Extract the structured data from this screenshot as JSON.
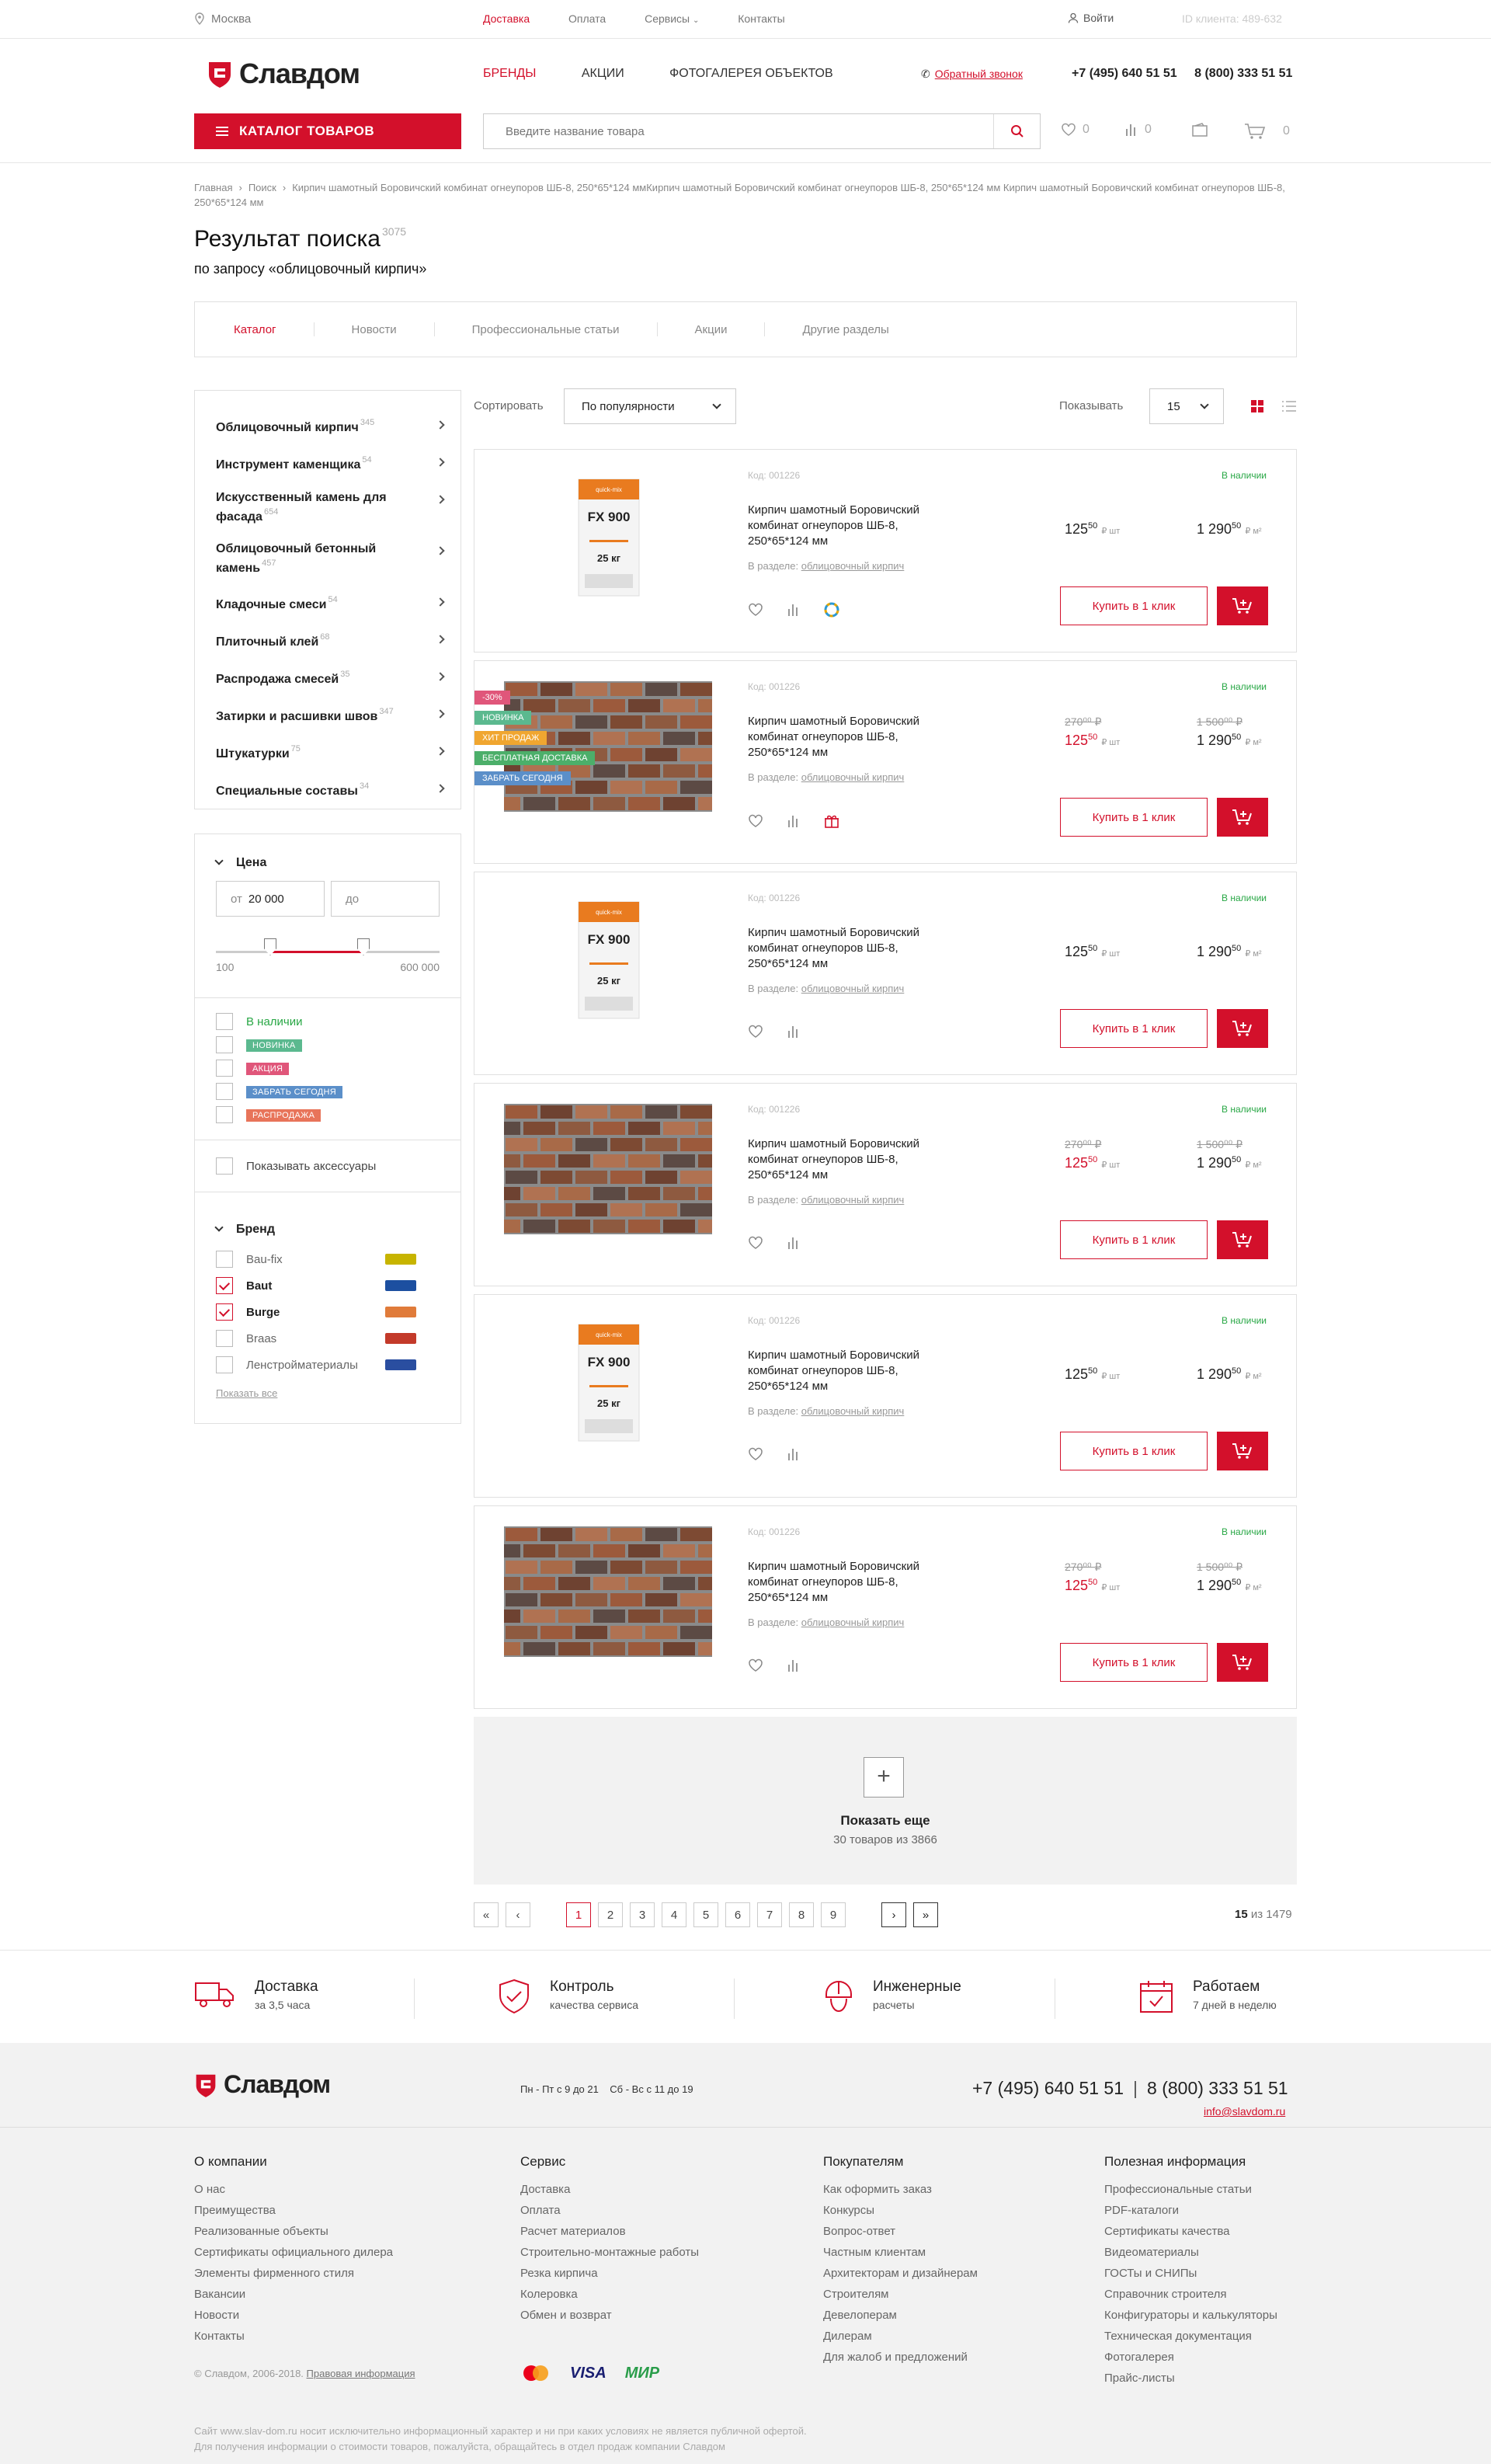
{
  "topbar": {
    "city": "Москва",
    "nav": [
      "Доставка",
      "Оплата",
      "Сервисы",
      "Контакты"
    ],
    "login": "Войти",
    "client_id": "ID клиента: 489-632"
  },
  "brand": {
    "name": "Славдом",
    "accent": "#d3102b"
  },
  "header": {
    "nav": [
      "БРЕНДЫ",
      "АКЦИИ",
      "ФОТОГАЛЕРЕЯ ОБЪЕКТОВ"
    ],
    "callback": "Обратный звонок",
    "phone1": "+7 (495) 640 51 51",
    "phone2": "8 (800) 333 51 51",
    "catalog": "КАТАЛОГ ТОВАРОВ",
    "search_placeholder": "Введите название товара",
    "fav_count": "0",
    "compare_count": "0",
    "cart_count": "0"
  },
  "breadcrumbs": [
    "Главная",
    "Поиск",
    "Кирпич шамотный Боровичский комбинат огнеупоров ШБ-8, 250*65*124 ммКирпич шамотный Боровичский комбинат огнеупоров ШБ-8, 250*65*124 мм Кирпич шамотный Боровичский комбинат огнеупоров ШБ-8, 250*65*124 мм"
  ],
  "page": {
    "title": "Результат поиска",
    "count": "3075",
    "subtitle": "по запросу «облицовочный кирпич»"
  },
  "tabs": [
    "Каталог",
    "Новости",
    "Профессиональные статьи",
    "Акции",
    "Другие разделы"
  ],
  "categories": [
    {
      "name": "Облицовочный кирпич",
      "count": "345"
    },
    {
      "name": "Инструмент каменщика",
      "count": "54"
    },
    {
      "name": "Искусственный камень для фасада",
      "count": "654"
    },
    {
      "name": "Облицовочный бетонный камень",
      "count": "457"
    },
    {
      "name": "Кладочные смеси",
      "count": "54"
    },
    {
      "name": "Плиточный клей",
      "count": "68"
    },
    {
      "name": "Распродажа смесей",
      "count": "35"
    },
    {
      "name": "Затирки и расшивки швов",
      "count": "347"
    },
    {
      "name": "Штукатурки",
      "count": "75"
    },
    {
      "name": "Специальные составы",
      "count": "34"
    }
  ],
  "filters": {
    "price_title": "Цена",
    "from_label": "от",
    "from_value": "20 000",
    "to_label": "до",
    "min": "100",
    "max": "600 000",
    "statuses": [
      {
        "label": "В наличии",
        "color": "#28a745"
      },
      {
        "label": "НОВИНКА",
        "color": "#5bb98f"
      },
      {
        "label": "АКЦИЯ",
        "color": "#e0567a"
      },
      {
        "label": "ЗАБРАТЬ СЕГОДНЯ",
        "color": "#5b8fc9"
      },
      {
        "label": "РАСПРОДАЖА",
        "color": "#e8745a"
      }
    ],
    "accessories": "Показывать аксессуары",
    "brand_title": "Бренд",
    "brands": [
      {
        "name": "Bau-fix",
        "checked": false,
        "logo_color": "#c7b400"
      },
      {
        "name": "Baut",
        "checked": true,
        "logo_color": "#1c4fa0"
      },
      {
        "name": "Burge",
        "checked": true,
        "logo_color": "#e07b3a"
      },
      {
        "name": "Braas",
        "checked": false,
        "logo_color": "#c33a2a"
      },
      {
        "name": "Ленстройматериалы",
        "checked": false,
        "logo_color": "#2a4ea0"
      }
    ],
    "show_all": "Показать все"
  },
  "sort": {
    "label": "Сортировать",
    "value": "По популярности",
    "show_label": "Показывать",
    "show_value": "15"
  },
  "products": [
    {
      "code": "Код: 001226",
      "stock": "В наличии",
      "name": "Кирпич шамотный Боровичский комбинат огнеупоров ШБ-8, 250*65*124 мм",
      "section_label": "В разделе:",
      "section": "облицовочный кирпич",
      "price_unit": "125",
      "price_unit_cents": "50",
      "unit1": "₽ шт",
      "price_m2": "1 290",
      "price_m2_cents": "50",
      "unit2": "₽ м²",
      "old1": "",
      "old2": "",
      "image": "bag",
      "badges": [],
      "buy": "Купить в 1 клик"
    },
    {
      "code": "Код: 001226",
      "stock": "В наличии",
      "name": "Кирпич шамотный Боровичский комбинат огнеупоров ШБ-8, 250*65*124 мм",
      "section_label": "В разделе:",
      "section": "облицовочный кирпич",
      "price_unit": "125",
      "price_unit_cents": "50",
      "unit1": "₽ шт",
      "price_m2": "1 290",
      "price_m2_cents": "50",
      "unit2": "₽ м²",
      "old1": "270⁰⁰ ₽",
      "old2": "1 500⁰⁰ ₽",
      "image": "brick",
      "badges": [
        {
          "label": "-30%",
          "color": "#e0567a"
        },
        {
          "label": "НОВИНКА",
          "color": "#5bb98f"
        },
        {
          "label": "ХИТ ПРОДАЖ",
          "color": "#f0a630"
        },
        {
          "label": "БЕСПЛАТНАЯ ДОСТАВКА",
          "color": "#4caf6a"
        },
        {
          "label": "ЗАБРАТЬ СЕГОДНЯ",
          "color": "#5b8fc9"
        }
      ],
      "buy": "Купить в 1 клик"
    },
    {
      "code": "Код: 001226",
      "stock": "В наличии",
      "name": "Кирпич шамотный Боровичский комбинат огнеупоров ШБ-8, 250*65*124 мм",
      "section_label": "В разделе:",
      "section": "облицовочный кирпич",
      "price_unit": "125",
      "price_unit_cents": "50",
      "unit1": "₽ шт",
      "price_m2": "1 290",
      "price_m2_cents": "50",
      "unit2": "₽ м²",
      "old1": "",
      "old2": "",
      "image": "bag",
      "badges": [],
      "buy": "Купить в 1 клик"
    },
    {
      "code": "Код: 001226",
      "stock": "В наличии",
      "name": "Кирпич шамотный Боровичский комбинат огнеупоров ШБ-8, 250*65*124 мм",
      "section_label": "В разделе:",
      "section": "облицовочный кирпич",
      "price_unit": "125",
      "price_unit_cents": "50",
      "unit1": "₽ шт",
      "price_m2": "1 290",
      "price_m2_cents": "50",
      "unit2": "₽ м²",
      "old1": "270⁰⁰ ₽",
      "old2": "1 500⁰⁰ ₽",
      "image": "brick",
      "badges": [],
      "buy": "Купить в 1 клик"
    },
    {
      "code": "Код: 001226",
      "stock": "В наличии",
      "name": "Кирпич шамотный Боровичский комбинат огнеупоров ШБ-8, 250*65*124 мм",
      "section_label": "В разделе:",
      "section": "облицовочный кирпич",
      "price_unit": "125",
      "price_unit_cents": "50",
      "unit1": "₽ шт",
      "price_m2": "1 290",
      "price_m2_cents": "50",
      "unit2": "₽ м²",
      "old1": "",
      "old2": "",
      "image": "bag",
      "badges": [],
      "buy": "Купить в 1 клик"
    },
    {
      "code": "Код: 001226",
      "stock": "В наличии",
      "name": "Кирпич шамотный Боровичский комбинат огнеупоров ШБ-8, 250*65*124 мм",
      "section_label": "В разделе:",
      "section": "облицовочный кирпич",
      "price_unit": "125",
      "price_unit_cents": "50",
      "unit1": "₽ шт",
      "price_m2": "1 290",
      "price_m2_cents": "50",
      "unit2": "₽ м²",
      "old1": "270⁰⁰ ₽",
      "old2": "1 500⁰⁰ ₽",
      "image": "brick",
      "badges": [],
      "buy": "Купить в 1 клик"
    }
  ],
  "bag_text": {
    "brand": "quick-mix",
    "model": "FX 900",
    "weight": "25 кг"
  },
  "more": {
    "title": "Показать еще",
    "sub": "30 товаров из 3866"
  },
  "pager": {
    "pages": [
      "1",
      "2",
      "3",
      "4",
      "5",
      "6",
      "7",
      "8",
      "9"
    ],
    "current": "1",
    "shown": "15",
    "total": "из 1479"
  },
  "features": [
    {
      "title": "Доставка",
      "sub": "за 3,5 часа"
    },
    {
      "title": "Контроль",
      "sub": "качества сервиса"
    },
    {
      "title": "Инженерные",
      "sub": "расчеты"
    },
    {
      "title": "Работаем",
      "sub": "7 дней в неделю"
    }
  ],
  "footer": {
    "hours1": "Пн - Пт с 9 до 21",
    "hours2": "Сб - Вс с 11 до 19",
    "phone1": "+7 (495) 640 51 51",
    "phone2": "8 (800) 333 51 51",
    "email": "info@slavdom.ru",
    "columns": [
      {
        "title": "О компании",
        "items": [
          "О нас",
          "Преимущества",
          "Реализованные объекты",
          "Сертификаты официального дилера",
          "Элементы фирменного стиля",
          "Вакансии",
          "Новости",
          "Контакты"
        ]
      },
      {
        "title": "Сервис",
        "items": [
          "Доставка",
          "Оплата",
          "Расчет материалов",
          "Строительно-монтажные работы",
          "Резка кирпича",
          "Колеровка",
          "Обмен и возврат"
        ]
      },
      {
        "title": "Покупателям",
        "items": [
          "Как оформить заказ",
          "Конкурсы",
          "Вопрос-ответ",
          "Частным клиентам",
          "Архитекторам и дизайнерам",
          "Строителям",
          "Девелоперам",
          "Дилерам",
          "Для жалоб и предложений"
        ]
      },
      {
        "title": "Полезная информация",
        "items": [
          "Профессиональные статьи",
          "PDF-каталоги",
          "Сертификаты качества",
          "Видеоматериалы",
          "ГОСТы и СНИПы",
          "Справочник строителя",
          "Конфигураторы и калькуляторы",
          "Техническая документация",
          "Фотогалерея",
          "Прайс-листы"
        ]
      }
    ],
    "copyright": "© Славдом, 2006-2018.",
    "legal": "Правовая информация",
    "pay": [
      "VISA",
      "МИР"
    ],
    "disclaimer1": "Сайт www.slav-dom.ru носит исключительно информационный характер и ни при каких условиях не является публичной офертой.",
    "disclaimer2": "Для получения информации о стоимости товаров, пожалуйста, обращайтесь в отдел продаж компании Славдом"
  }
}
